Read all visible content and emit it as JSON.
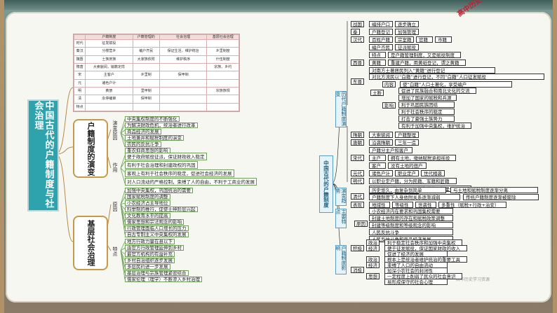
{
  "left": {
    "main_title": "中国古代的户籍制度与社会治理",
    "table": {
      "headers": [
        "",
        "户籍制度",
        "户籍管理的",
        "社会治理",
        "基层社会治理"
      ],
      "rows": [
        [
          "时代",
          "征发赋役",
          "",
          "",
          ""
        ],
        [
          "秦汉",
          "分楼营乡",
          "编户齐民",
          "保证生活，维护统治",
          "乡里制度"
        ],
        [
          "魏晋",
          "士族庶族",
          "大家族依附",
          "维护秩序",
          "什伍制度"
        ],
        [
          "隋唐",
          "大索貌阅，输籍定样",
          "",
          "",
          "宗族、乡约"
        ],
        [
          "宋",
          "主客户",
          "乡里制",
          "保甲制",
          ""
        ],
        [
          "元",
          "诸色户计",
          "",
          "",
          ""
        ],
        [
          "明",
          "黄册",
          "里甲制",
          "",
          "宗族族规"
        ],
        [
          "清",
          "永停编审",
          "保甲制",
          "",
          ""
        ],
        [
          "特点",
          "",
          "",
          "",
          ""
        ]
      ]
    },
    "section1": {
      "title": "户籍制度的演变",
      "cause_label": "演变原因",
      "cause_items": [
        "中央集权制度的不断强化",
        "为解决财政危机，统治者进行改革",
        "商品经济的发展",
        "土地兼并和赋税制度的演变",
        "农民的反抗斗争",
        "重农抑商思想的影响"
      ],
      "effect_label": "作用",
      "effect_items": [
        "便于政府赋役征派，保证财政收入稳定",
        "有利于社会治理和封建政权的巩固",
        "客观上有利于社会秩序的稳定，促进社会经济的发展",
        "对人口流动的严格控制，束缚了人的自由，不利于工商业的发展"
      ]
    },
    "section2": {
      "title": "基层社会治理",
      "cause_label": "原因",
      "cause_items": [
        "加强中央集权，巩固统治的需要",
        "国家赋税制度的调整",
        "小农经济占主导地位",
        "科举制的推行，促使士绅阶层兴起",
        "文化教育水平的提高",
        "儒家思想和宗法观念的影响",
        "行政管理面临人口增长的压力",
        "自古专制主义中央集权的发展"
      ],
      "feature_label": "特点",
      "feature_items": [
        "地方行政力量在县以下",
        "由官方行政管理延伸到乡村",
        "最官方机构的有益补充",
        "乡村自治组织逐步发展",
        "多层民约进一步发展",
        "基层治理与宗族管理紧密结合",
        "儒家伦理（理学）不断渗入乡村治理"
      ]
    }
  },
  "right": {
    "watermark": "高中历史学习资源",
    "watermark_small": "高中历史学习资源",
    "center_title": "中国古代的户籍制度",
    "cat1": "历代户籍制度演变",
    "cat2": "演变趋势",
    "cat3": "主要特点",
    "cat4": "户籍制度影响",
    "dynasties": [
      {
        "name": "战国",
        "items": [
          "编排户口",
          "逐步确立"
        ]
      },
      {
        "name": "秦",
        "items": [
          "户籍登记",
          "加强管理"
        ]
      },
      {
        "name": "汉代",
        "items": [
          "百姓户籍",
          "宗室籍",
          "官籍",
          "市籍"
        ]
      },
      {
        "name": "",
        "items": [
          "编户齐民",
          "征派赋役"
        ]
      },
      {
        "name": "",
        "items": [
          "特点",
          "是户籍管理制度，又是赋役制度"
        ]
      },
      {
        "name": "西晋",
        "items": [
          "黄籍",
          "重建户籍，用黄纸登记，谓之黄籍"
        ]
      }
    ],
    "dongjin": {
      "name": "东晋",
      "lines": [
        "对南方土著居民列入“黄籍”进行登记",
        "对北方流民以“白籍”进行登记，不同“白籍”人口征发赋役"
      ],
      "tuduan": "土断",
      "content_label": "内容",
      "content": "使“白籍”人口土著化，享受编户",
      "impact_label": "影响",
      "impact": [
        "促进了民族融合和南北文化的交流",
        "增加了国家的赋税和兵源",
        "利于巩固民族团结",
        "利于社会秩序的稳定",
        "打击了豪强士族势力",
        "有利于加强中央集权，维护统治"
      ]
    },
    "later": [
      {
        "name": "隋朝",
        "items": [
          "大索貌阅",
          "户籍整理"
        ]
      },
      {
        "name": "唐朝",
        "items": [
          "沿袭隋朝",
          "三年一造"
        ]
      },
      {
        "name": "",
        "items": [
          "户籍分主户和客户"
        ]
      },
      {
        "name": "宋代",
        "items": [
          "主户",
          "拥有土地，缴纳赋税承担徭役"
        ]
      },
      {
        "name": "",
        "items": [
          "客户",
          "没有土地的佃户"
        ]
      },
      {
        "name": "元代",
        "items": [
          "诸色户计",
          "职业定户",
          "世代相袭"
        ]
      },
      {
        "name": "明代",
        "items": [
          "以职业定户籍，分为民籍、军籍和匠籍"
        ]
      },
      {
        "name": "",
        "items": [
          "户籍制度“黄册”以里甲制为单位，每里一册"
        ]
      },
      {
        "name": "清代",
        "items": [
          "永停编审",
          "管理松弛"
        ]
      }
    ],
    "trend": [
      "历史悠久，由复杂到简单",
      "与土地和赋税制度逐渐分离",
      "户籍制度下人身依附关系逐渐减弱",
      "传统户籍制度逐渐被废除"
    ],
    "features": [
      "地域性",
      "等级性",
      "世袭性",
      "多重性（赋税+行政+治安）"
    ],
    "features_label": "表现",
    "reasons_label": "原因",
    "reasons": [
      "小农经济内在要求和巩固集权需要",
      "封建土地制度的存在和赋税政策调整",
      "封建等级制度和等级观念的影响",
      "人民反抗斗争",
      "人民反抗斗争和商品经济发展"
    ],
    "impact_pos_label": "积极",
    "impact_neg_label": "消极",
    "impact_rows": [
      {
        "k": "政治",
        "v": "利于稳定社会秩序和加强中央集权"
      },
      {
        "k": "经济",
        "v": "便于征发赋役，保证国家财政的收入"
      },
      {
        "k": "",
        "v": "促进了经济的发展"
      },
      {
        "k": "政治",
        "v": "根本上是统治者维护统治的重要工具"
      },
      {
        "k": "经济",
        "v": "束缚了人口的自由流动"
      },
      {
        "k": "",
        "v": "加深小农社会的封闭性"
      },
      {
        "k": "思想",
        "v": "一定程度上削弱了民众的社会意识"
      },
      {
        "k": "",
        "v": "易形成保守的社会心理"
      }
    ]
  }
}
